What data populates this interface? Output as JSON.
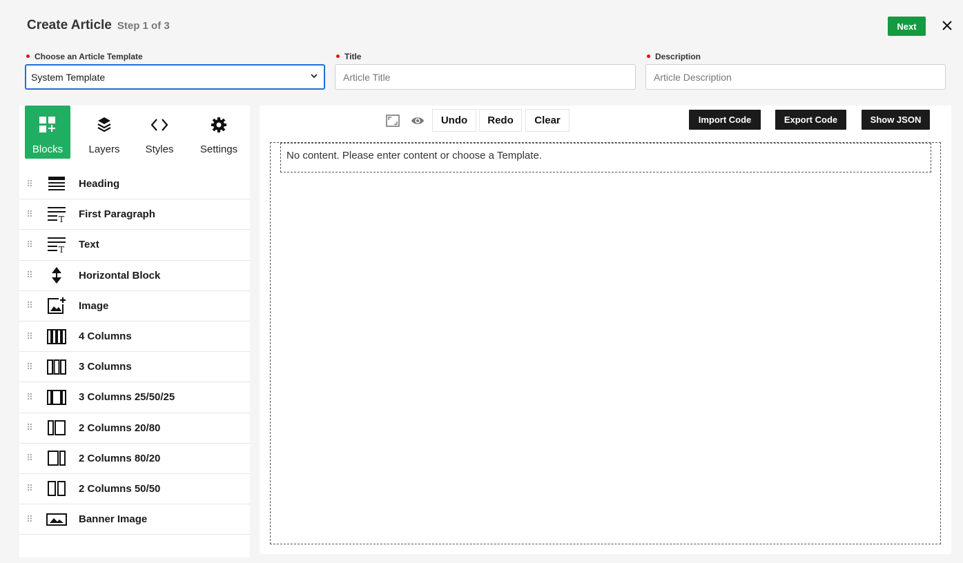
{
  "header": {
    "title": "Create Article",
    "step": "Step 1 of 3",
    "next_label": "Next"
  },
  "fields": {
    "template": {
      "label": "Choose an Article Template",
      "value": "System Template"
    },
    "title": {
      "label": "Title",
      "placeholder": "Article Title"
    },
    "description": {
      "label": "Description",
      "placeholder": "Article Description"
    }
  },
  "tabs": [
    {
      "label": "Blocks",
      "icon": "blocks-icon",
      "active": true
    },
    {
      "label": "Layers",
      "icon": "layers-icon"
    },
    {
      "label": "Styles",
      "icon": "code-icon"
    },
    {
      "label": "Settings",
      "icon": "gear-icon"
    }
  ],
  "blocks": [
    {
      "label": "Heading",
      "icon": "heading-icon"
    },
    {
      "label": "First Paragraph",
      "icon": "paragraph-icon"
    },
    {
      "label": "Text",
      "icon": "text-icon"
    },
    {
      "label": "Horizontal Block",
      "icon": "horizontal-block-icon"
    },
    {
      "label": "Image",
      "icon": "image-add-icon"
    },
    {
      "label": "4 Columns",
      "icon": "four-columns-icon"
    },
    {
      "label": "3 Columns",
      "icon": "three-columns-icon"
    },
    {
      "label": "3 Columns 25/50/25",
      "icon": "three-columns-25-50-25-icon"
    },
    {
      "label": "2 Columns 20/80",
      "icon": "two-columns-20-80-icon"
    },
    {
      "label": "2 Columns 80/20",
      "icon": "two-columns-80-20-icon"
    },
    {
      "label": "2 Columns 50/50",
      "icon": "two-columns-50-50-icon"
    },
    {
      "label": "Banner Image",
      "icon": "banner-image-icon"
    }
  ],
  "toolbar": {
    "undo": "Undo",
    "redo": "Redo",
    "clear": "Clear",
    "import": "Import Code",
    "export": "Export Code",
    "json": "Show JSON"
  },
  "canvas": {
    "placeholder": "No content. Please enter content or choose a Template."
  },
  "colors": {
    "accent": "#22ae62",
    "next": "#159a42",
    "required": "#dd1111",
    "focus": "#1d6fd6"
  }
}
